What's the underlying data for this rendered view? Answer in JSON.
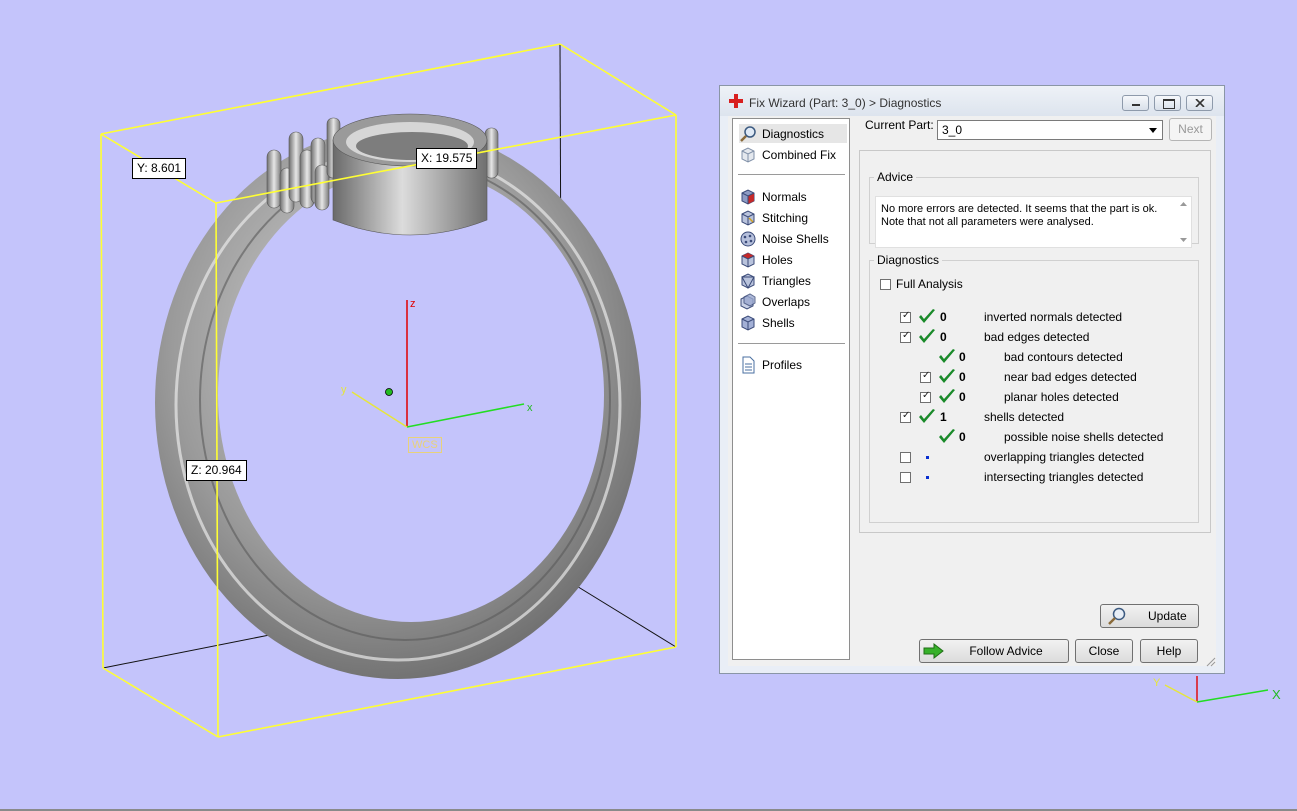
{
  "viewport": {
    "dims": {
      "y": "Y: 8.601",
      "x": "X: 19.575",
      "z": "Z: 20.964"
    },
    "axes": {
      "z": "z",
      "y": "y",
      "x": "x",
      "wcs": "WCS"
    },
    "corner_axes": {
      "x": "X",
      "y": "Y"
    }
  },
  "wizard": {
    "title": "Fix Wizard (Part: 3_0) > Diagnostics",
    "nav": {
      "top": [
        "Diagnostics",
        "Combined Fix"
      ],
      "tools": [
        "Normals",
        "Stitching",
        "Noise Shells",
        "Holes",
        "Triangles",
        "Overlaps",
        "Shells"
      ],
      "bottom": [
        "Profiles"
      ]
    },
    "current_part_label": "Current Part:",
    "current_part_value": "3_0",
    "next_label": "Next",
    "advice": {
      "legend": "Advice",
      "text": "No more errors are detected. It seems that the part is ok. Note that not all parameters were analysed."
    },
    "diagnostics": {
      "legend": "Diagnostics",
      "full_analysis": "Full Analysis",
      "rows": [
        {
          "checkbox": true,
          "checked": true,
          "status": "ok",
          "count": "0",
          "label": "inverted normals detected",
          "indent": 0
        },
        {
          "checkbox": true,
          "checked": true,
          "status": "ok",
          "count": "0",
          "label": "bad edges detected",
          "indent": 0
        },
        {
          "checkbox": false,
          "checked": false,
          "status": "ok",
          "count": "0",
          "label": "bad contours detected",
          "indent": 1
        },
        {
          "checkbox": true,
          "checked": true,
          "status": "ok",
          "count": "0",
          "label": "near bad edges detected",
          "indent": 1
        },
        {
          "checkbox": true,
          "checked": true,
          "status": "ok",
          "count": "0",
          "label": "planar holes detected",
          "indent": 1
        },
        {
          "checkbox": true,
          "checked": true,
          "status": "ok",
          "count": "1",
          "label": "shells detected",
          "indent": 0
        },
        {
          "checkbox": false,
          "checked": false,
          "status": "ok",
          "count": "0",
          "label": "possible noise shells detected",
          "indent": 1
        },
        {
          "checkbox": true,
          "checked": false,
          "status": "pending",
          "count": "",
          "label": "overlapping triangles detected",
          "indent": 0
        },
        {
          "checkbox": true,
          "checked": false,
          "status": "pending",
          "count": "",
          "label": "intersecting triangles detected",
          "indent": 0
        }
      ],
      "update_label": "Update"
    },
    "buttons": {
      "follow_advice": "Follow Advice",
      "close": "Close",
      "help": "Help"
    }
  }
}
